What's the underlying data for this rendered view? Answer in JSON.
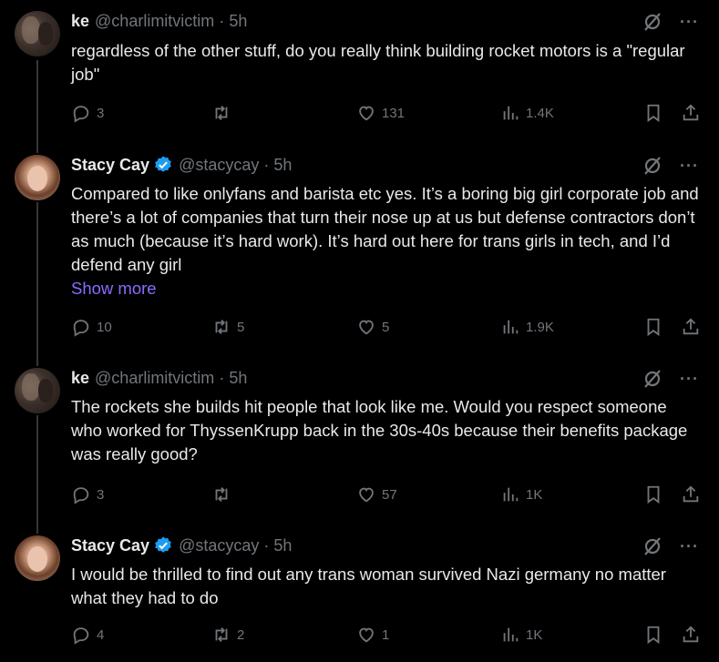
{
  "posts": [
    {
      "author": "ke",
      "handle": "@charlimitvictim",
      "separator": "·",
      "time": "5h",
      "verified": false,
      "avatar": "ke-avatar",
      "text": "regardless of the other stuff, do you really think building rocket motors is a \"regular job\"",
      "show_more": "",
      "replies": "3",
      "reposts": "",
      "likes": "131",
      "views": "1.4K"
    },
    {
      "author": "Stacy Cay",
      "handle": "@stacycay",
      "separator": "·",
      "time": "5h",
      "verified": true,
      "avatar": "stacy-avatar",
      "text": "Compared to like onlyfans and barista etc yes. It’s a boring big girl corporate job and there’s a lot of companies that turn their nose up at us but defense contractors don’t as much (because it’s hard work). It’s hard out here for trans girls in tech, and I’d defend any girl",
      "show_more": "Show more",
      "replies": "10",
      "reposts": "5",
      "likes": "5",
      "views": "1.9K"
    },
    {
      "author": "ke",
      "handle": "@charlimitvictim",
      "separator": "·",
      "time": "5h",
      "verified": false,
      "avatar": "ke-avatar",
      "text": "The rockets she builds hit people that look like me. Would you respect someone who worked for ThyssenKrupp back in the 30s-40s because their benefits package was really good?",
      "show_more": "",
      "replies": "3",
      "reposts": "",
      "likes": "57",
      "views": "1K"
    },
    {
      "author": "Stacy Cay",
      "handle": "@stacycay",
      "separator": "·",
      "time": "5h",
      "verified": true,
      "avatar": "stacy-avatar",
      "text": "I would be thrilled to find out any trans woman survived Nazi germany no matter what they had to do",
      "show_more": "",
      "replies": "4",
      "reposts": "2",
      "likes": "1",
      "views": "1K"
    }
  ],
  "colors": {
    "background": "#000000",
    "text": "#e7e9ea",
    "muted": "#71767b",
    "verified": "#1d9bf0",
    "link": "#8b6cff",
    "thread_line": "#333639"
  }
}
